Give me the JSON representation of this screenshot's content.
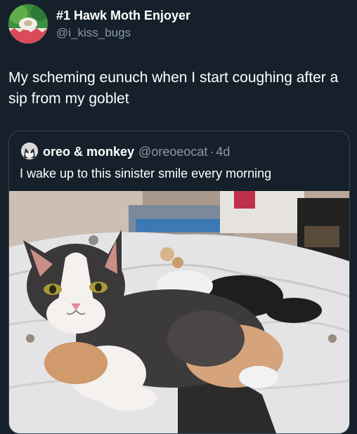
{
  "author": {
    "display_name": "#1 Hawk Moth Enjoyer",
    "handle": "@i_kiss_bugs",
    "avatar_icon": "avatar-image"
  },
  "tweet": {
    "text": "My scheming eunuch when I start coughing after a sip from my goblet"
  },
  "quoted_tweet": {
    "display_name": "oreo & monkey",
    "handle": "@oreoeocat",
    "separator": "·",
    "age": "4d",
    "text": "I wake up to this sinister smile every morning",
    "media_icon": "cat-photo"
  },
  "colors": {
    "background": "#15202b",
    "secondary_text": "#8b98a5",
    "border": "#38444d"
  }
}
